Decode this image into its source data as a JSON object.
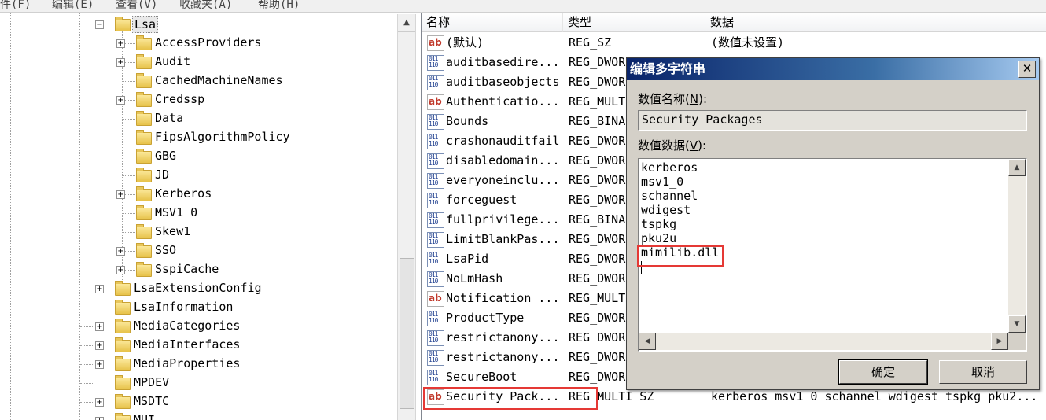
{
  "menu": {
    "items": [
      "件(F)",
      "编辑(E)",
      "查看(V)",
      "收藏夹(A)",
      "帮助(H)"
    ]
  },
  "tree": {
    "selected": "Lsa",
    "lsa_children": [
      {
        "label": "AccessProviders",
        "expandable": true
      },
      {
        "label": "Audit",
        "expandable": true
      },
      {
        "label": "CachedMachineNames",
        "expandable": false
      },
      {
        "label": "Credssp",
        "expandable": true
      },
      {
        "label": "Data",
        "expandable": false
      },
      {
        "label": "FipsAlgorithmPolicy",
        "expandable": false
      },
      {
        "label": "GBG",
        "expandable": false
      },
      {
        "label": "JD",
        "expandable": false
      },
      {
        "label": "Kerberos",
        "expandable": true
      },
      {
        "label": "MSV1_0",
        "expandable": false
      },
      {
        "label": "Skew1",
        "expandable": false
      },
      {
        "label": "SSO",
        "expandable": true
      },
      {
        "label": "SspiCache",
        "expandable": true
      }
    ],
    "siblings": [
      {
        "label": "LsaExtensionConfig",
        "expandable": true
      },
      {
        "label": "LsaInformation",
        "expandable": false
      },
      {
        "label": "MediaCategories",
        "expandable": true
      },
      {
        "label": "MediaInterfaces",
        "expandable": true
      },
      {
        "label": "MediaProperties",
        "expandable": true
      },
      {
        "label": "MPDEV",
        "expandable": false
      },
      {
        "label": "MSDTC",
        "expandable": true
      },
      {
        "label": "MUI",
        "expandable": true
      }
    ]
  },
  "list": {
    "columns": [
      "名称",
      "类型",
      "数据"
    ],
    "rows": [
      {
        "icon": "string-value-icon",
        "name": "(默认)",
        "type": "REG_SZ",
        "data": "(数值未设置)"
      },
      {
        "icon": "binary-value-icon",
        "name": "auditbasedire...",
        "type": "REG_DWOR",
        "data": ""
      },
      {
        "icon": "binary-value-icon",
        "name": "auditbaseobjects",
        "type": "REG_DWOR",
        "data": ""
      },
      {
        "icon": "string-value-icon",
        "name": "Authenticatio...",
        "type": "REG_MULT",
        "data": ""
      },
      {
        "icon": "binary-value-icon",
        "name": "Bounds",
        "type": "REG_BINA",
        "data": ""
      },
      {
        "icon": "binary-value-icon",
        "name": "crashonauditfail",
        "type": "REG_DWOR",
        "data": ""
      },
      {
        "icon": "binary-value-icon",
        "name": "disabledomain...",
        "type": "REG_DWOR",
        "data": ""
      },
      {
        "icon": "binary-value-icon",
        "name": "everyoneinclu...",
        "type": "REG_DWOR",
        "data": ""
      },
      {
        "icon": "binary-value-icon",
        "name": "forceguest",
        "type": "REG_DWOR",
        "data": ""
      },
      {
        "icon": "binary-value-icon",
        "name": "fullprivilege...",
        "type": "REG_BINA",
        "data": ""
      },
      {
        "icon": "binary-value-icon",
        "name": "LimitBlankPas...",
        "type": "REG_DWOR",
        "data": ""
      },
      {
        "icon": "binary-value-icon",
        "name": "LsaPid",
        "type": "REG_DWOR",
        "data": ""
      },
      {
        "icon": "binary-value-icon",
        "name": "NoLmHash",
        "type": "REG_DWOR",
        "data": ""
      },
      {
        "icon": "string-value-icon",
        "name": "Notification ...",
        "type": "REG_MULT",
        "data": ""
      },
      {
        "icon": "binary-value-icon",
        "name": "ProductType",
        "type": "REG_DWOR",
        "data": ""
      },
      {
        "icon": "binary-value-icon",
        "name": "restrictanony...",
        "type": "REG_DWOR",
        "data": ""
      },
      {
        "icon": "binary-value-icon",
        "name": "restrictanony...",
        "type": "REG_DWOR",
        "data": ""
      },
      {
        "icon": "binary-value-icon",
        "name": "SecureBoot",
        "type": "REG_DWOR",
        "data": ""
      },
      {
        "icon": "string-value-icon",
        "name": "Security Pack...",
        "type": "REG_MULTI_SZ",
        "data": "kerberos msv1_0 schannel wdigest tspkg pku2..."
      }
    ]
  },
  "dialog": {
    "title": "编辑多字符串",
    "close_label": "✕",
    "name_label": "数值名称(",
    "name_key": "N",
    "name_label_end": "):",
    "name_value": "Security Packages",
    "data_label": "数值数据(",
    "data_key": "V",
    "data_label_end": "):",
    "data_lines": [
      "kerberos",
      "msv1_0",
      "schannel",
      "wdigest",
      "tspkg",
      "pku2u",
      "mimilib.dll"
    ],
    "ok_label": "确定",
    "cancel_label": "取消"
  },
  "highlight_color": "#e53935"
}
